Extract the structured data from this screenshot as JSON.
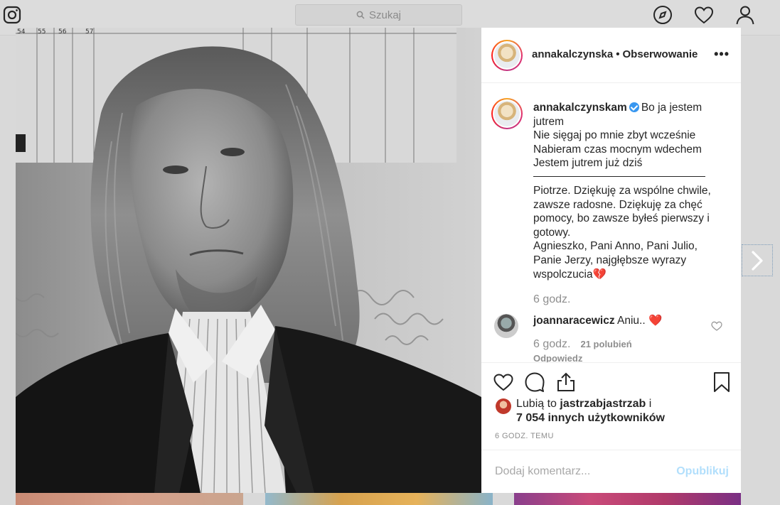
{
  "topbar": {
    "search_placeholder": "Szukaj",
    "icons": [
      "instagram-icon",
      "explore-icon",
      "heart-icon",
      "profile-icon"
    ]
  },
  "post": {
    "header": {
      "username": "annakalczynska",
      "separator": "•",
      "follow_status": "Obserwowanie",
      "more_label": "•••"
    },
    "caption": {
      "username": "annakalczynskam",
      "verified": true,
      "line1": "Bo ja jestem jutrem",
      "line2": "Nie sięgaj po mnie zbyt wcześnie",
      "line3": "Nabieram czas mocnym wdechem",
      "line4": "Jestem jutrem już dziś",
      "para2": "Piotrze. Dziękuję za wspólne chwile, zawsze radosne. Dziękuję za chęć pomocy, bo zawsze byłeś pierwszy i gotowy.",
      "para3": "Agnieszko, Pani Anno, Pani Julio, Panie Jerzy, najgłębsze wyrazy wspolczucia",
      "para3_emoji": "💔",
      "time": "6 godz."
    },
    "comment": {
      "username": "joannaracewicz",
      "text": "Aniu..",
      "emoji": "❤️",
      "time": "6 godz.",
      "likes": "21 polubień",
      "reply": "Odpowiedz"
    },
    "likes": {
      "prefix": "Lubią to",
      "user": "jastrzabjastrzab",
      "conj": "i",
      "others": "7 054 innych użytkowników"
    },
    "posted_ago": "6 GODZ. TEMU",
    "add_comment": {
      "placeholder": "Dodaj komentarz...",
      "publish_label": "Opublikuj"
    }
  },
  "photo": {
    "chart_labels": [
      "54",
      "55",
      "56",
      "57"
    ]
  }
}
